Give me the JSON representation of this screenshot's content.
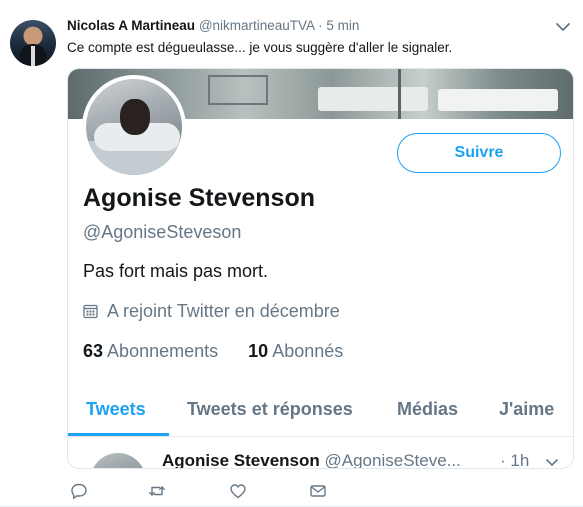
{
  "tweet": {
    "author_name": "Nicolas A Martineau",
    "author_handle": "@nikmartineauTVA",
    "dot": "·",
    "time": "5 min",
    "text": "Ce compte est dégueulasse... je vous suggère d'aller le signaler."
  },
  "profile": {
    "name": "Agonise Stevenson",
    "handle": "@AgoniseSteveson",
    "bio": "Pas fort mais pas mort.",
    "joined": "A rejoint Twitter en décembre",
    "following_count": "63",
    "following_label": "Abonnements",
    "followers_count": "10",
    "followers_label": "Abonnés",
    "follow_label": "Suivre"
  },
  "tabs": [
    {
      "label": "Tweets",
      "active": true
    },
    {
      "label": "Tweets et réponses",
      "active": false
    },
    {
      "label": "Médias",
      "active": false
    },
    {
      "label": "J'aime",
      "active": false
    }
  ],
  "inner_tweet": {
    "name": "Agonise Stevenson",
    "handle": "@AgoniseSteve...",
    "time": "· 1h"
  },
  "colors": {
    "accent": "#1da1f2",
    "text": "#14171a",
    "muted": "#657786"
  },
  "icons": [
    "chevron-down-icon",
    "calendar-icon",
    "reply-icon",
    "retweet-icon",
    "like-icon",
    "message-icon"
  ]
}
